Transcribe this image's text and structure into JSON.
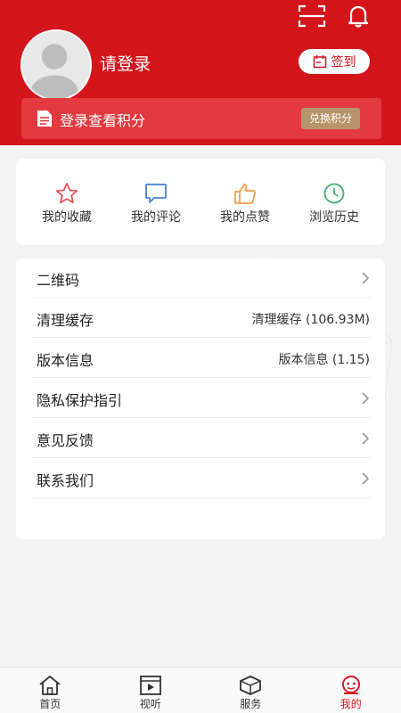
{
  "header": {
    "login_prompt": "请登录",
    "signin_label": "签到",
    "points_text": "登录查看积分",
    "exchange_label": "兑换积分"
  },
  "quick_actions": [
    {
      "label": "我的收藏",
      "icon": "star-icon",
      "color": "#e8525a"
    },
    {
      "label": "我的评论",
      "icon": "comment-icon",
      "color": "#4a7fd6"
    },
    {
      "label": "我的点赞",
      "icon": "thumbs-up-icon",
      "color": "#f0a04a"
    },
    {
      "label": "浏览历史",
      "icon": "clock-icon",
      "color": "#3fae72"
    }
  ],
  "menu": [
    {
      "label": "二维码",
      "value": "",
      "chevron": true
    },
    {
      "label": "清理缓存",
      "value": "清理缓存 (106.93M)",
      "chevron": false
    },
    {
      "label": "版本信息",
      "value": "版本信息 (1.15)",
      "chevron": false
    },
    {
      "label": "隐私保护指引",
      "value": "",
      "chevron": true
    },
    {
      "label": "意见反馈",
      "value": "",
      "chevron": true
    },
    {
      "label": "联系我们",
      "value": "",
      "chevron": true
    }
  ],
  "tabs": [
    {
      "label": "首页",
      "icon": "home-icon"
    },
    {
      "label": "视听",
      "icon": "video-icon"
    },
    {
      "label": "服务",
      "icon": "box-icon"
    },
    {
      "label": "我的",
      "icon": "profile-icon",
      "active": true
    }
  ],
  "colors": {
    "brand_red": "#d3161c",
    "points_bar": "#e23a3e",
    "exchange_btn": "#b8946a"
  }
}
